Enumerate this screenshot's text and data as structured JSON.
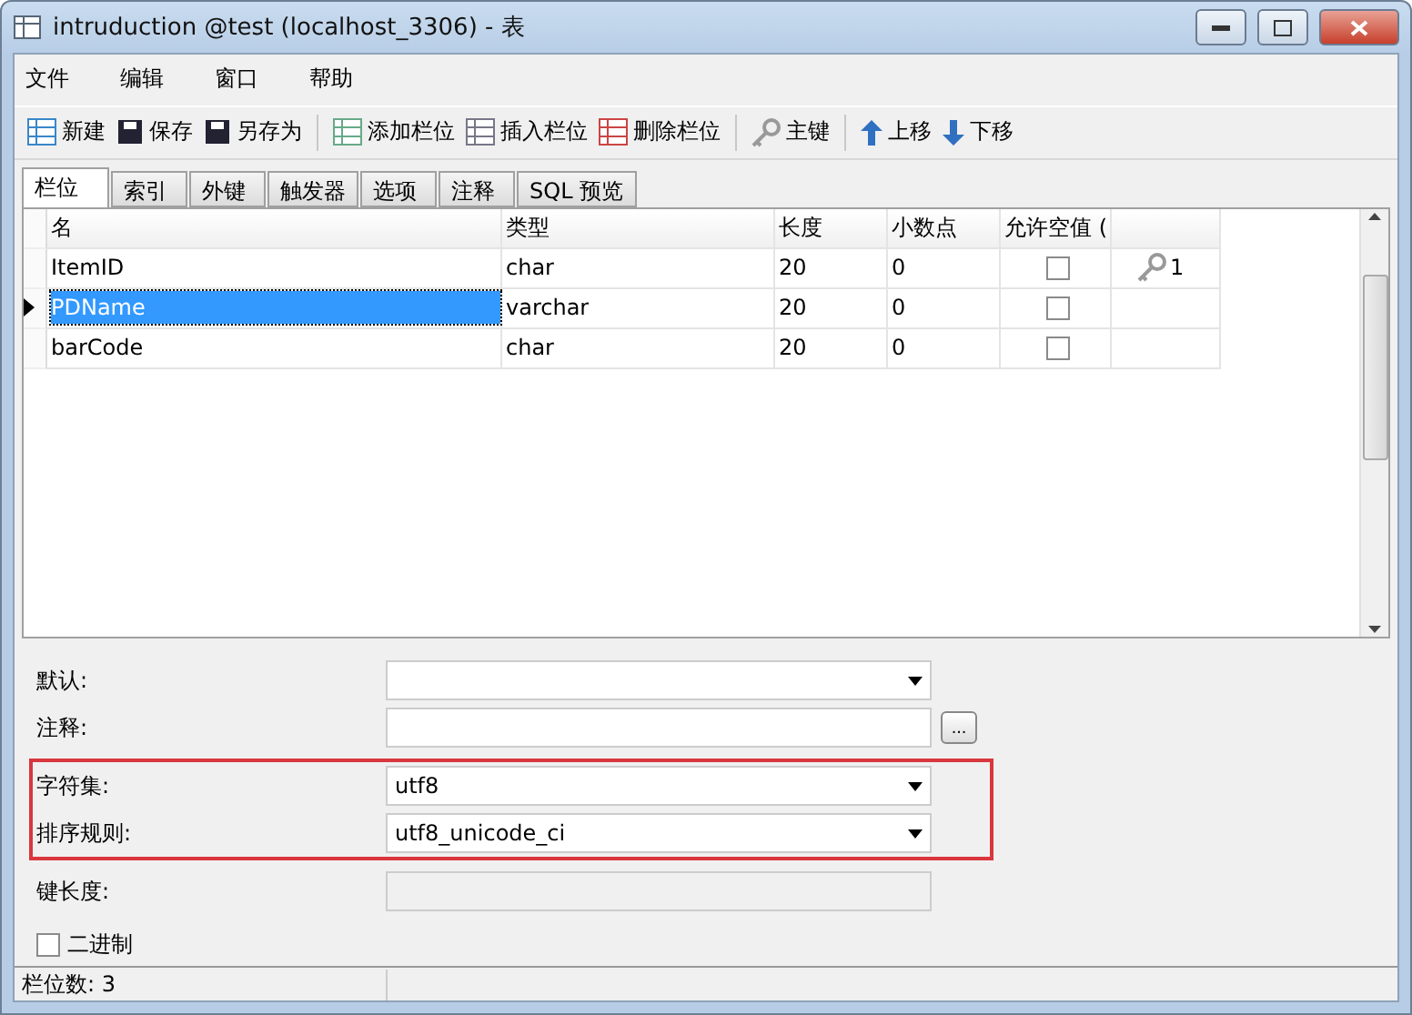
{
  "window": {
    "title": "intruduction @test (localhost_3306) - 表"
  },
  "menu": [
    "文件",
    "编辑",
    "窗口",
    "帮助"
  ],
  "toolbar": [
    [
      "新建",
      "保存",
      "另存为"
    ],
    [
      "添加栏位",
      "插入栏位",
      "删除栏位"
    ],
    [
      "主键"
    ],
    [
      "上移",
      "下移"
    ]
  ],
  "tabs": [
    {
      "label": "栏位",
      "selected": true
    },
    {
      "label": "索引",
      "selected": false
    },
    {
      "label": "外键",
      "selected": false
    },
    {
      "label": "触发器",
      "selected": false
    },
    {
      "label": "选项",
      "selected": false
    },
    {
      "label": "注释",
      "selected": false
    },
    {
      "label": "SQL 预览",
      "selected": false
    }
  ],
  "table": {
    "columns": [
      "名",
      "类型",
      "长度",
      "小数点",
      "允许空值 ("
    ],
    "rows": [
      {
        "name": "ItemID",
        "type": "char",
        "length": "20",
        "decimals": "0",
        "nullable": false,
        "key": "1",
        "selected": false
      },
      {
        "name": "PDName",
        "type": "varchar",
        "length": "20",
        "decimals": "0",
        "nullable": false,
        "selected": true
      },
      {
        "name": "barCode",
        "type": "char",
        "length": "20",
        "decimals": "0",
        "nullable": false,
        "selected": false
      }
    ]
  },
  "field_groups": [
    {
      "highlighted": false,
      "fields": [
        {
          "kind": "dropdown",
          "label": "默认:"
        },
        {
          "kind": "text-button",
          "label": "注释:",
          "button": "..."
        }
      ]
    },
    {
      "highlighted": true,
      "fields": [
        {
          "kind": "dropdown",
          "label": "字符集:",
          "value": "utf8"
        },
        {
          "kind": "dropdown",
          "label": "排序规则:",
          "value": "utf8_unicode_ci"
        }
      ]
    },
    {
      "highlighted": false,
      "fields": [
        {
          "kind": "readonly",
          "label": "键长度:"
        }
      ]
    }
  ],
  "binary": {
    "label": "二进制",
    "checked": false
  },
  "status_bar": "栏位数: 3"
}
